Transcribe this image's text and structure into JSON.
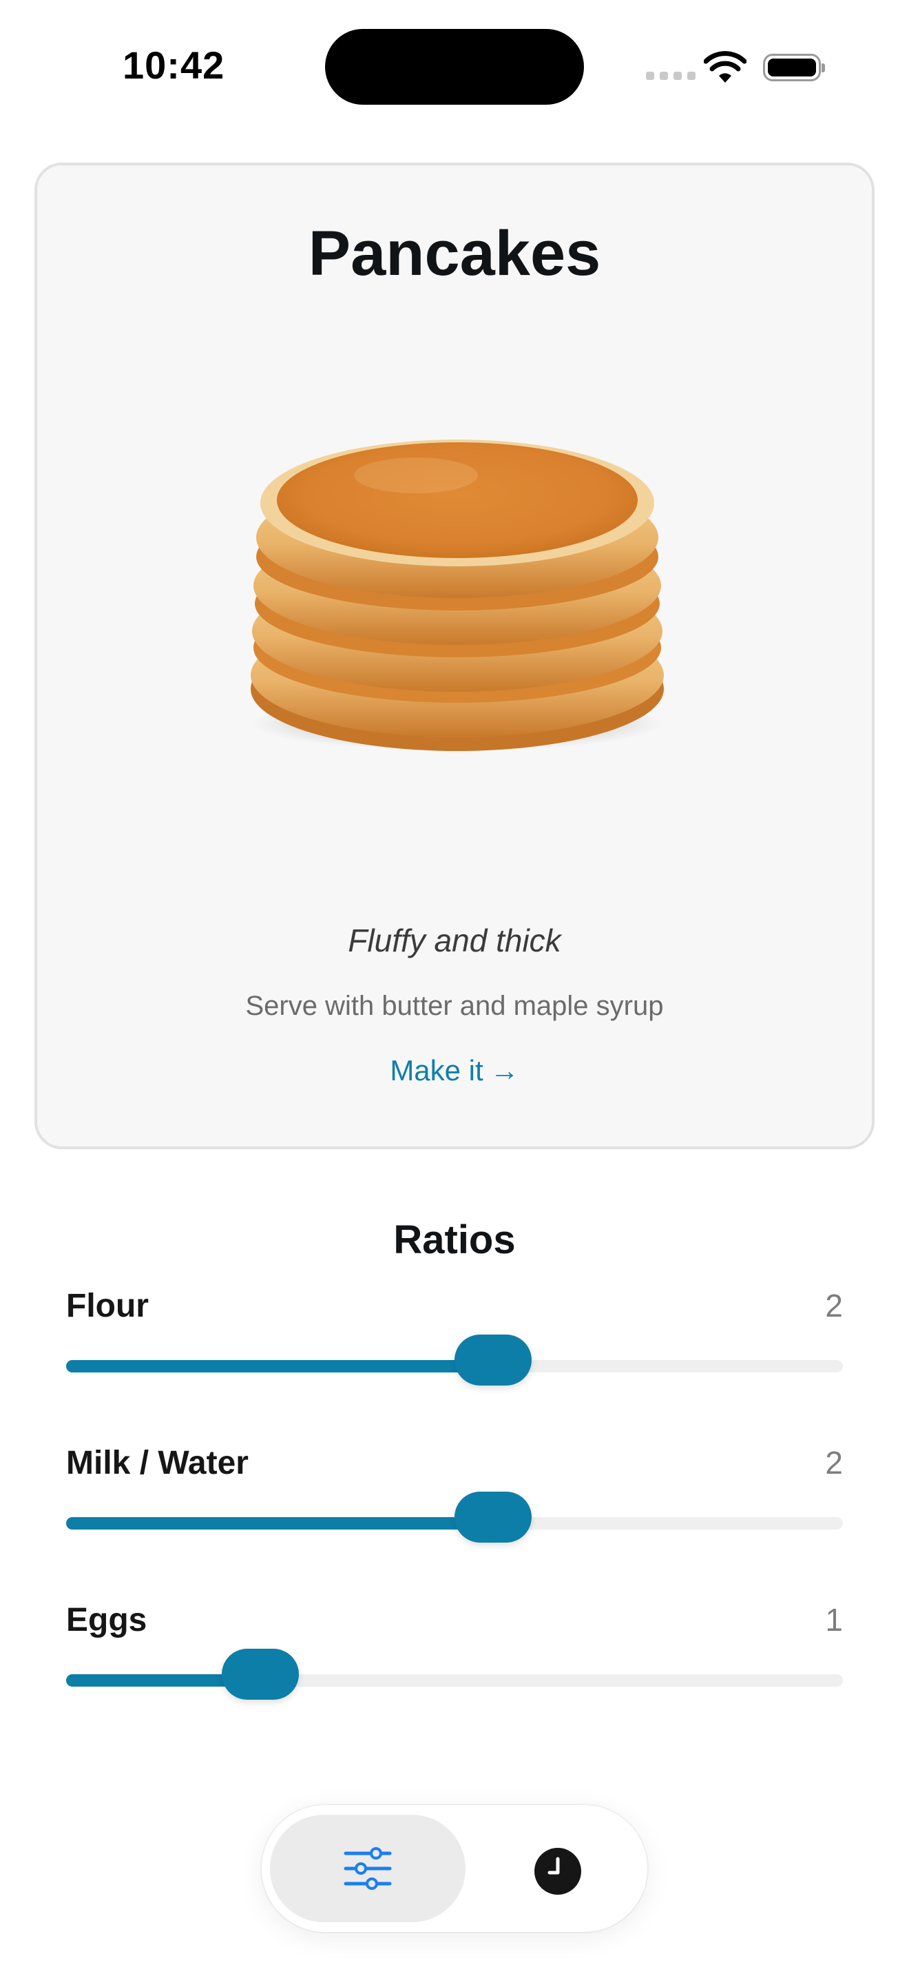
{
  "status_bar": {
    "time": "10:42",
    "icons": [
      "cellular-signal-icon",
      "wifi-icon",
      "battery-icon"
    ]
  },
  "recipe": {
    "title": "Pancakes",
    "image": "pancake-stack-image",
    "tagline": "Fluffy and thick",
    "serving_note": "Serve with butter and maple syrup",
    "action_label": "Make it",
    "action_arrow": "→"
  },
  "ratios": {
    "title": "Ratios",
    "items": [
      {
        "label": "Flour",
        "value": "2",
        "level": 0.55
      },
      {
        "label": "Milk / Water",
        "value": "2",
        "level": 0.55
      },
      {
        "label": "Eggs",
        "value": "1",
        "level": 0.25
      }
    ]
  },
  "tab_bar": {
    "tabs": [
      {
        "icon": "sliders-icon",
        "selected": true
      },
      {
        "icon": "clock-icon",
        "selected": false
      }
    ]
  },
  "colors": {
    "accent": "#0d7ea8",
    "link": "#107ea9",
    "card_background": "#f7f7f7",
    "track": "#efefef",
    "selected_tab": "#ebebeb",
    "tab_icon_selected": "#1a7ff0"
  }
}
